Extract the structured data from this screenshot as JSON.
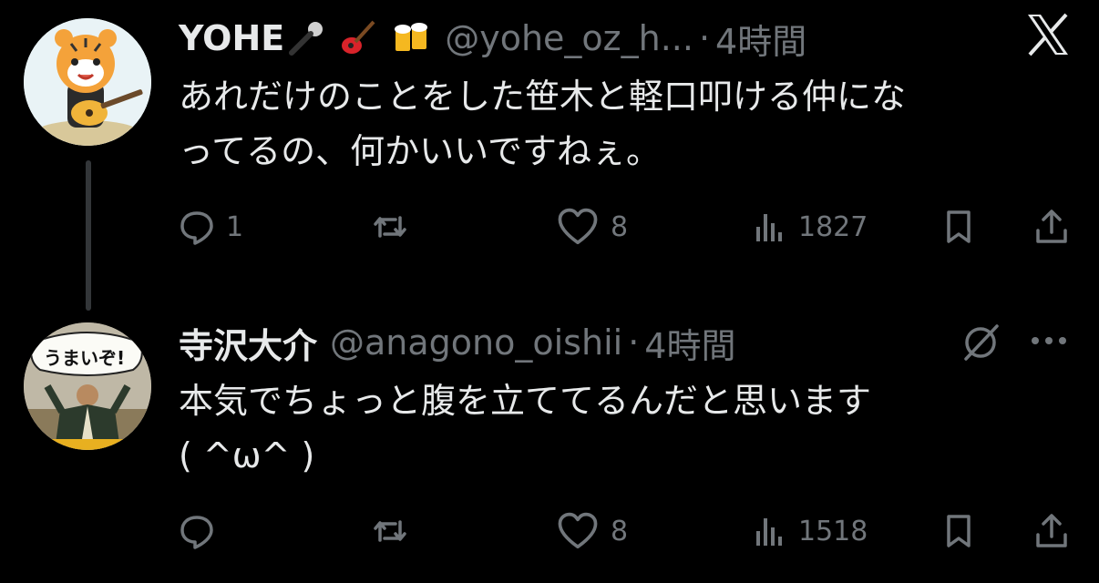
{
  "tweets": [
    {
      "name": "YOHE",
      "name_emojis": [
        "microphone-emoji",
        "guitar-emoji",
        "beer-mugs-emoji"
      ],
      "handle": "@yohe_oz_h...",
      "dot": "·",
      "time": "4時間",
      "text": "あれだけのことをした笹木と軽口叩ける仲にな\nってるの、何かいいですねぇ。",
      "reply_count": "1",
      "retweet_count": "",
      "like_count": "8",
      "view_count": "1827",
      "avatar": "tiger-guitar-avatar",
      "corner_icon": "x-logo-icon"
    },
    {
      "name": "寺沢大介",
      "handle": "@anagono_oishii",
      "dot": "·",
      "time": "4時間",
      "text": "本気でちょっと腹を立ててるんだと思います\n( ^ω^ )",
      "reply_count": "",
      "retweet_count": "",
      "like_count": "8",
      "view_count": "1518",
      "avatar": "umaizo-person-avatar",
      "corner_icons": [
        "grok-icon",
        "more-icon"
      ]
    }
  ]
}
